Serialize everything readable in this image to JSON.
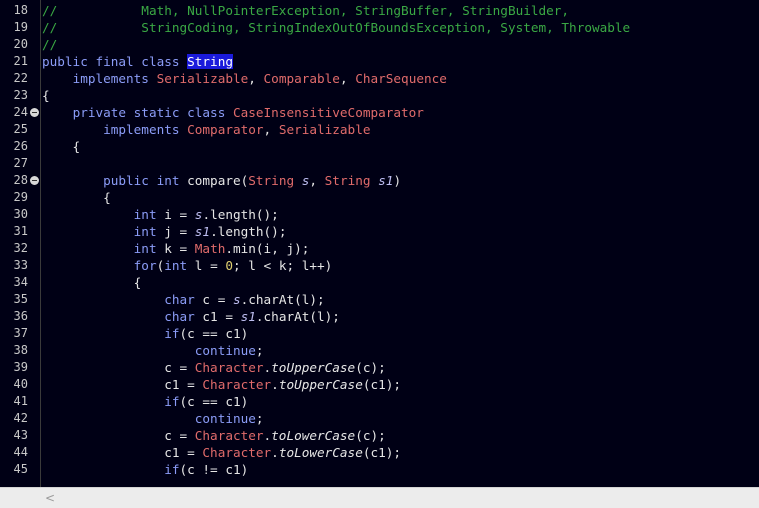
{
  "editor": {
    "lines": [
      {
        "n": "18",
        "fold": false,
        "tokens": [
          [
            "comment",
            "//           Math, NullPointerException, StringBuffer, StringBuilder,"
          ]
        ]
      },
      {
        "n": "19",
        "fold": false,
        "tokens": [
          [
            "comment",
            "//           StringCoding, StringIndexOutOfBoundsException, System, Throwable"
          ]
        ]
      },
      {
        "n": "20",
        "fold": false,
        "tokens": [
          [
            "comment",
            "//"
          ]
        ]
      },
      {
        "n": "21",
        "fold": false,
        "tokens": [
          [
            "keyword",
            "public final class "
          ],
          [
            "highlight",
            "String"
          ]
        ]
      },
      {
        "n": "22",
        "fold": false,
        "tokens": [
          [
            "plain",
            "    "
          ],
          [
            "keyword",
            "implements "
          ],
          [
            "type",
            "Serializable"
          ],
          [
            "plain",
            ", "
          ],
          [
            "type",
            "Comparable"
          ],
          [
            "plain",
            ", "
          ],
          [
            "type",
            "CharSequence"
          ]
        ]
      },
      {
        "n": "23",
        "fold": false,
        "tokens": [
          [
            "plain",
            "{"
          ]
        ]
      },
      {
        "n": "24",
        "fold": true,
        "tokens": [
          [
            "plain",
            "    "
          ],
          [
            "keyword",
            "private static class "
          ],
          [
            "type",
            "CaseInsensitiveComparator"
          ]
        ]
      },
      {
        "n": "25",
        "fold": false,
        "tokens": [
          [
            "plain",
            "        "
          ],
          [
            "keyword",
            "implements "
          ],
          [
            "type",
            "Comparator"
          ],
          [
            "plain",
            ", "
          ],
          [
            "type",
            "Serializable"
          ]
        ]
      },
      {
        "n": "26",
        "fold": false,
        "tokens": [
          [
            "plain",
            "    {"
          ]
        ]
      },
      {
        "n": "27",
        "fold": false,
        "tokens": [
          [
            "plain",
            ""
          ]
        ]
      },
      {
        "n": "28",
        "fold": true,
        "tokens": [
          [
            "plain",
            "        "
          ],
          [
            "keyword",
            "public int "
          ],
          [
            "method",
            "compare"
          ],
          [
            "plain",
            "("
          ],
          [
            "type",
            "String "
          ],
          [
            "param",
            "s"
          ],
          [
            "plain",
            ", "
          ],
          [
            "type",
            "String "
          ],
          [
            "param",
            "s1"
          ],
          [
            "plain",
            ")"
          ]
        ]
      },
      {
        "n": "29",
        "fold": false,
        "tokens": [
          [
            "plain",
            "        {"
          ]
        ]
      },
      {
        "n": "30",
        "fold": false,
        "tokens": [
          [
            "plain",
            "            "
          ],
          [
            "keyword",
            "int "
          ],
          [
            "plain",
            "i = "
          ],
          [
            "param",
            "s"
          ],
          [
            "plain",
            ".length();"
          ]
        ]
      },
      {
        "n": "31",
        "fold": false,
        "tokens": [
          [
            "plain",
            "            "
          ],
          [
            "keyword",
            "int "
          ],
          [
            "plain",
            "j = "
          ],
          [
            "param",
            "s1"
          ],
          [
            "plain",
            ".length();"
          ]
        ]
      },
      {
        "n": "32",
        "fold": false,
        "tokens": [
          [
            "plain",
            "            "
          ],
          [
            "keyword",
            "int "
          ],
          [
            "plain",
            "k = "
          ],
          [
            "type",
            "Math"
          ],
          [
            "plain",
            ".min(i, j);"
          ]
        ]
      },
      {
        "n": "33",
        "fold": false,
        "tokens": [
          [
            "plain",
            "            "
          ],
          [
            "keyword",
            "for"
          ],
          [
            "plain",
            "("
          ],
          [
            "keyword",
            "int "
          ],
          [
            "plain",
            "l = "
          ],
          [
            "number",
            "0"
          ],
          [
            "plain",
            "; l < k; l++)"
          ]
        ]
      },
      {
        "n": "34",
        "fold": false,
        "tokens": [
          [
            "plain",
            "            {"
          ]
        ]
      },
      {
        "n": "35",
        "fold": false,
        "tokens": [
          [
            "plain",
            "                "
          ],
          [
            "keyword",
            "char "
          ],
          [
            "plain",
            "c = "
          ],
          [
            "param",
            "s"
          ],
          [
            "plain",
            ".charAt(l);"
          ]
        ]
      },
      {
        "n": "36",
        "fold": false,
        "tokens": [
          [
            "plain",
            "                "
          ],
          [
            "keyword",
            "char "
          ],
          [
            "plain",
            "c1 = "
          ],
          [
            "param",
            "s1"
          ],
          [
            "plain",
            ".charAt(l);"
          ]
        ]
      },
      {
        "n": "37",
        "fold": false,
        "tokens": [
          [
            "plain",
            "                "
          ],
          [
            "keyword",
            "if"
          ],
          [
            "plain",
            "(c == c1)"
          ]
        ]
      },
      {
        "n": "38",
        "fold": false,
        "tokens": [
          [
            "plain",
            "                    "
          ],
          [
            "keyword",
            "continue"
          ],
          [
            "plain",
            ";"
          ]
        ]
      },
      {
        "n": "39",
        "fold": false,
        "tokens": [
          [
            "plain",
            "                c = "
          ],
          [
            "type",
            "Character"
          ],
          [
            "plain",
            "."
          ],
          [
            "static",
            "toUpperCase"
          ],
          [
            "plain",
            "(c);"
          ]
        ]
      },
      {
        "n": "40",
        "fold": false,
        "tokens": [
          [
            "plain",
            "                c1 = "
          ],
          [
            "type",
            "Character"
          ],
          [
            "plain",
            "."
          ],
          [
            "static",
            "toUpperCase"
          ],
          [
            "plain",
            "(c1);"
          ]
        ]
      },
      {
        "n": "41",
        "fold": false,
        "tokens": [
          [
            "plain",
            "                "
          ],
          [
            "keyword",
            "if"
          ],
          [
            "plain",
            "(c == c1)"
          ]
        ]
      },
      {
        "n": "42",
        "fold": false,
        "tokens": [
          [
            "plain",
            "                    "
          ],
          [
            "keyword",
            "continue"
          ],
          [
            "plain",
            ";"
          ]
        ]
      },
      {
        "n": "43",
        "fold": false,
        "tokens": [
          [
            "plain",
            "                c = "
          ],
          [
            "type",
            "Character"
          ],
          [
            "plain",
            "."
          ],
          [
            "static",
            "toLowerCase"
          ],
          [
            "plain",
            "(c);"
          ]
        ]
      },
      {
        "n": "44",
        "fold": false,
        "tokens": [
          [
            "plain",
            "                c1 = "
          ],
          [
            "type",
            "Character"
          ],
          [
            "plain",
            "."
          ],
          [
            "static",
            "toLowerCase"
          ],
          [
            "plain",
            "(c1);"
          ]
        ]
      },
      {
        "n": "45",
        "fold": false,
        "tokens": [
          [
            "plain",
            "                "
          ],
          [
            "keyword",
            "if"
          ],
          [
            "plain",
            "(c != c1)"
          ]
        ]
      }
    ]
  },
  "scrollbar": {
    "left_arrow": "<"
  }
}
